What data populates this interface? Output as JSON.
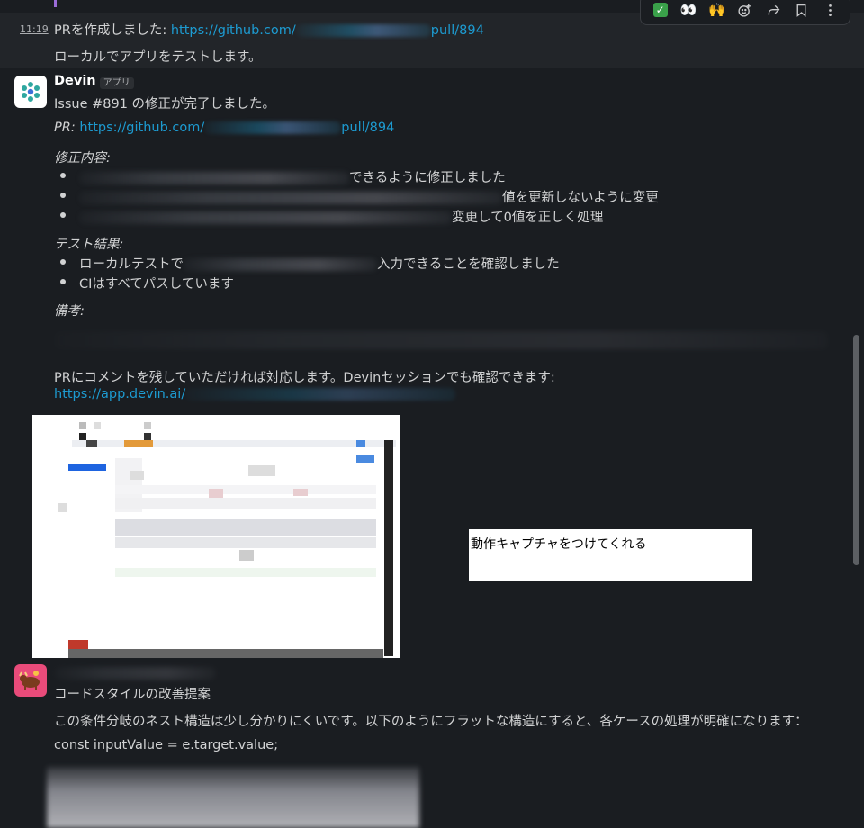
{
  "toolbar": {
    "check_label": "✓",
    "eyes_label": "👀",
    "hands_label": "🙌",
    "icons": [
      "check-reaction-icon",
      "eyes-reaction-icon",
      "raised-hands-reaction-icon",
      "add-reaction-icon",
      "share-icon",
      "bookmark-icon",
      "more-icon"
    ]
  },
  "prev_message": {
    "time": "11:19",
    "line1_prefix": "PRを作成しました: ",
    "line1_link_start": "https://github.com/",
    "line1_link_end": "pull/894",
    "line2": "ローカルでアプリをテストします。"
  },
  "devin_message": {
    "name": "Devin",
    "badge": "アプリ",
    "line1": "Issue #891 の修正が完了しました。",
    "pr_label": "PR: ",
    "pr_link_start": "https://github.com/",
    "pr_link_end": "pull/894",
    "fix_heading": "修正内容:",
    "fix_items": [
      "できるように修正しました",
      "値を更新しないように変更",
      "変更して0値を正しく処理"
    ],
    "test_heading": "テスト結果:",
    "test_items": [
      "入力できることを確認しました",
      "CIはすべてパスしています"
    ],
    "test_item1_prefix": "ローカルテストで",
    "notes_heading": "備考:",
    "comment_line": "PRにコメントを残していただければ対応します。Devinセッションでも確認できます:",
    "session_link": "https://app.devin.ai/"
  },
  "caption": "動作キャプチャをつけてくれる",
  "bot_message": {
    "title": "コードスタイルの改善提案",
    "body": "この条件分岐のネスト構造は少し分かりにくいです。以下のようにフラットな構造にすると、各ケースの処理が明確になります：",
    "code_line": "const inputValue = e.target.value;"
  },
  "colors": {
    "background": "#1a1d21",
    "link": "#1d9bd1",
    "text": "#d1d2d3"
  }
}
